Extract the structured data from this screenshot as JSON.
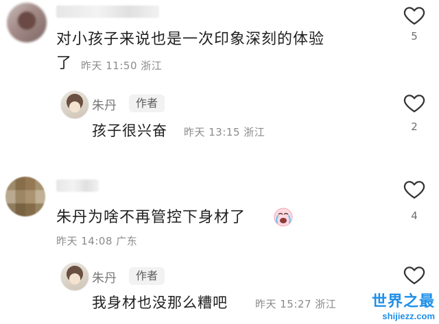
{
  "comments": [
    {
      "text_line1": "对小孩子来说也是一次印象深刻的体验",
      "text_line2": "了",
      "time": "昨天 11:50",
      "location": "浙江",
      "likes": "5",
      "reply": {
        "author": "朱丹",
        "badge": "作者",
        "text": "孩子很兴奋",
        "time": "昨天 13:15",
        "location": "浙江",
        "likes": "2"
      }
    },
    {
      "text_line1": "朱丹为啥不再管控下身材了",
      "time": "昨天 14:08",
      "location": "广东",
      "likes": "4",
      "emoji": "crying-face",
      "reply": {
        "author": "朱丹",
        "badge": "作者",
        "text": "我身材也没那么糟吧",
        "time": "昨天 15:27",
        "location": "浙江",
        "likes": ""
      }
    }
  ],
  "watermark": {
    "logo": "世界之最",
    "url": "shijiezz.com"
  },
  "colors": {
    "text": "#1f1f1f",
    "meta": "#8a8a8a",
    "watermark": "#1e8fe8"
  }
}
